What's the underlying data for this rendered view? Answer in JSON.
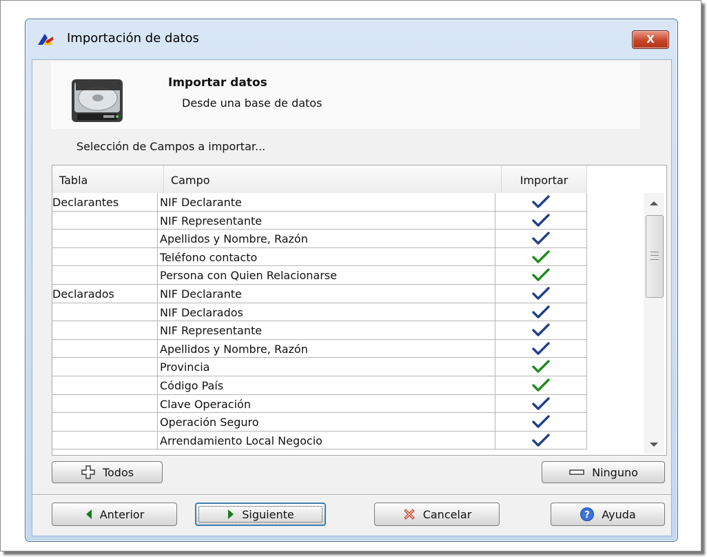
{
  "window": {
    "title": "Importación de datos",
    "close_label": "X"
  },
  "header": {
    "title": "Importar datos",
    "subtitle": "Desde una base de datos"
  },
  "section_label": "Selección de Campos a importar...",
  "table": {
    "columns": [
      "Tabla",
      "Campo",
      "Importar"
    ],
    "rows": [
      {
        "tabla": "Declarantes",
        "campo": "NIF Declarante",
        "check_color": "#1f3f8a"
      },
      {
        "tabla": "",
        "campo": "NIF Representante",
        "check_color": "#1f3f8a"
      },
      {
        "tabla": "",
        "campo": "Apellidos y Nombre, Razón",
        "check_color": "#1f3f8a"
      },
      {
        "tabla": "",
        "campo": "Teléfono contacto",
        "check_color": "#1e8a1e"
      },
      {
        "tabla": "",
        "campo": "Persona con Quien Relacionarse",
        "check_color": "#1e8a1e"
      },
      {
        "tabla": "Declarados",
        "campo": "NIF Declarante",
        "check_color": "#1f3f8a"
      },
      {
        "tabla": "",
        "campo": "NIF Declarados",
        "check_color": "#1f3f8a"
      },
      {
        "tabla": "",
        "campo": "NIF Representante",
        "check_color": "#1f3f8a"
      },
      {
        "tabla": "",
        "campo": "Apellidos y Nombre, Razón",
        "check_color": "#1f3f8a"
      },
      {
        "tabla": "",
        "campo": "Provincia",
        "check_color": "#1e8a1e"
      },
      {
        "tabla": "",
        "campo": "Código País",
        "check_color": "#1e8a1e"
      },
      {
        "tabla": "",
        "campo": "Clave Operación",
        "check_color": "#1f3f8a"
      },
      {
        "tabla": "",
        "campo": "Operación Seguro",
        "check_color": "#1f3f8a"
      },
      {
        "tabla": "",
        "campo": "Arrendamiento Local Negocio",
        "check_color": "#1f3f8a"
      }
    ]
  },
  "buttons": {
    "todos": "Todos",
    "ninguno": "Ninguno",
    "anterior": "Anterior",
    "siguiente": "Siguiente",
    "cancelar": "Cancelar",
    "ayuda": "Ayuda"
  }
}
